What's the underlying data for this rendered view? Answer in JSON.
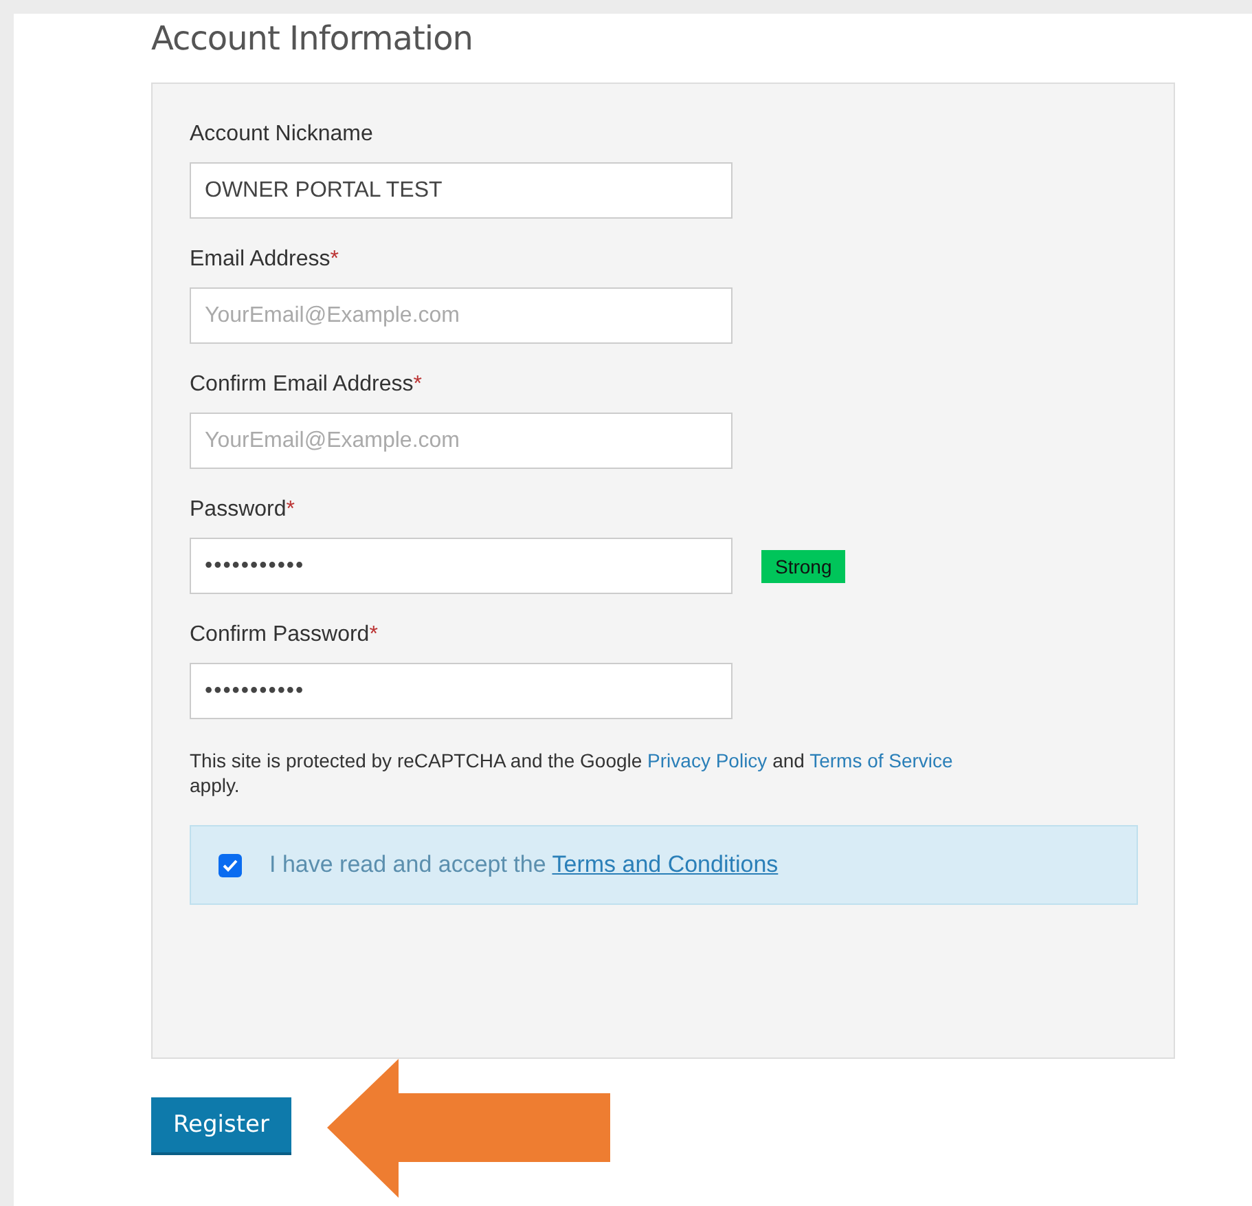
{
  "heading": "Account Information",
  "fields": [
    {
      "label": "Account Nickname",
      "required": false,
      "value": "OWNER PORTAL TEST"
    },
    {
      "label": "Email Address",
      "required": true,
      "placeholder": "YourEmail@Example.com"
    },
    {
      "label": "Confirm Email Address",
      "required": true,
      "placeholder": "YourEmail@Example.com"
    },
    {
      "label": "Password",
      "required": true,
      "value": "•••••••••••",
      "badge": "Strong"
    },
    {
      "label": "Confirm Password",
      "required": true,
      "value": "•••••••••••"
    }
  ],
  "required_mark": "*",
  "recaptcha": {
    "before": "This site is protected by reCAPTCHA and the Google ",
    "link_1": "Privacy Policy",
    "middle": " and ",
    "link_2": "Terms of Service",
    "after": " apply."
  },
  "terms": {
    "checked": true,
    "text": "I have read and accept the ",
    "link": "Terms and Conditions"
  },
  "register_button": "Register"
}
